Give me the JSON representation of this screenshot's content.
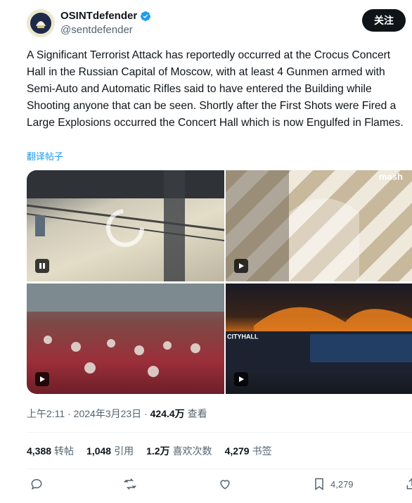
{
  "author": {
    "name": "OSINTdefender",
    "handle": "@sentdefender",
    "verified": true
  },
  "follow_label": "关注",
  "tweet": {
    "text": "A Significant Terrorist Attack has reportedly occurred at the Crocus Concert Hall in the Russian Capital of Moscow, with at least 4 Gunmen armed with Semi-Auto and Automatic Rifles said to have entered the Building while Shooting anyone that can be seen. Shortly after the First Shots were Fired a Large Explosions occurred the Concert Hall which is now Engulfed in Flames.",
    "translate_label": "翻译帖子"
  },
  "media": {
    "watermark": "mash",
    "overlay_label": "CITYHALL"
  },
  "meta": {
    "time": "上午2:11",
    "date": "2024年3月23日",
    "views": "424.4万",
    "views_label": "查看"
  },
  "stats": {
    "reposts": "4,388",
    "reposts_label": "转帖",
    "quotes": "1,048",
    "quotes_label": "引用",
    "likes": "1.2万",
    "likes_label": "喜欢次数",
    "bookmarks": "4,279",
    "bookmarks_label": "书签"
  },
  "actions": {
    "bookmark_count": "4,279"
  },
  "colors": {
    "accent": "#1d9bf0",
    "text": "#0f1419",
    "muted": "#536471"
  }
}
